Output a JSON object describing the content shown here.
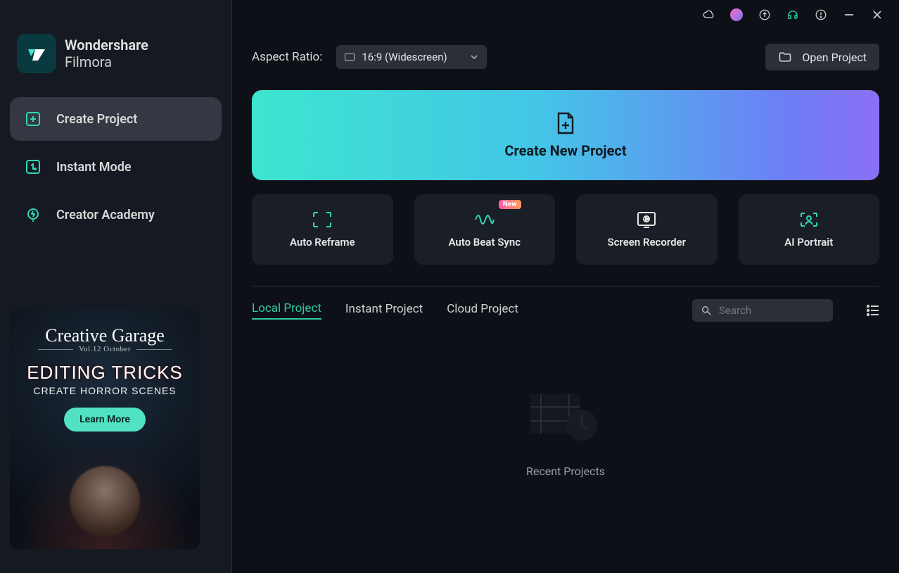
{
  "brand": {
    "line1": "Wondershare",
    "line2": "Filmora"
  },
  "sidebar": {
    "items": [
      {
        "label": "Create Project"
      },
      {
        "label": "Instant Mode"
      },
      {
        "label": "Creator Academy"
      }
    ]
  },
  "promo": {
    "script": "Creative Garage",
    "issue": "Vol.12 October",
    "title": "EDITING TRICKS",
    "subtitle": "CREATE HORROR SCENES",
    "cta": "Learn More"
  },
  "top": {
    "aspect_label": "Aspect Ratio:",
    "aspect_value": "16:9 (Widescreen)",
    "open_project": "Open Project"
  },
  "create_new": "Create New Project",
  "features": [
    {
      "label": "Auto Reframe",
      "badge": ""
    },
    {
      "label": "Auto Beat Sync",
      "badge": "New"
    },
    {
      "label": "Screen Recorder",
      "badge": ""
    },
    {
      "label": "AI Portrait",
      "badge": ""
    }
  ],
  "tabs": [
    {
      "label": "Local Project"
    },
    {
      "label": "Instant Project"
    },
    {
      "label": "Cloud Project"
    }
  ],
  "search": {
    "placeholder": "Search"
  },
  "recent_label": "Recent Projects"
}
